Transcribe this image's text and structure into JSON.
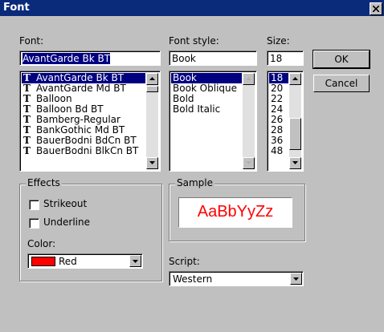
{
  "window": {
    "title": "Font"
  },
  "font": {
    "label": "Font:",
    "value": "AvantGarde Bk BT",
    "items": [
      "AvantGarde Bk BT",
      "AvantGarde Md BT",
      "Balloon",
      "Balloon Bd BT",
      "Bamberg-Regular",
      "BankGothic Md BT",
      "BauerBodni BdCn BT",
      "BauerBodni BlkCn BT"
    ],
    "item_icon": "truetype-icon"
  },
  "style": {
    "label": "Font style:",
    "value": "Book",
    "items": [
      "Book",
      "Book Oblique",
      "Bold",
      "Bold Italic"
    ]
  },
  "size": {
    "label": "Size:",
    "value": "18",
    "items": [
      "18",
      "20",
      "22",
      "24",
      "26",
      "28",
      "36",
      "48"
    ]
  },
  "buttons": {
    "ok": "OK",
    "cancel": "Cancel"
  },
  "effects": {
    "title": "Effects",
    "strikeout": "Strikeout",
    "underline": "Underline",
    "color_label": "Color:",
    "color_value": "Red",
    "color_hex": "#ff0000"
  },
  "sample": {
    "title": "Sample",
    "text": "AaBbYyZz",
    "color": "#ff0000"
  },
  "script": {
    "label": "Script:",
    "value": "Western"
  }
}
